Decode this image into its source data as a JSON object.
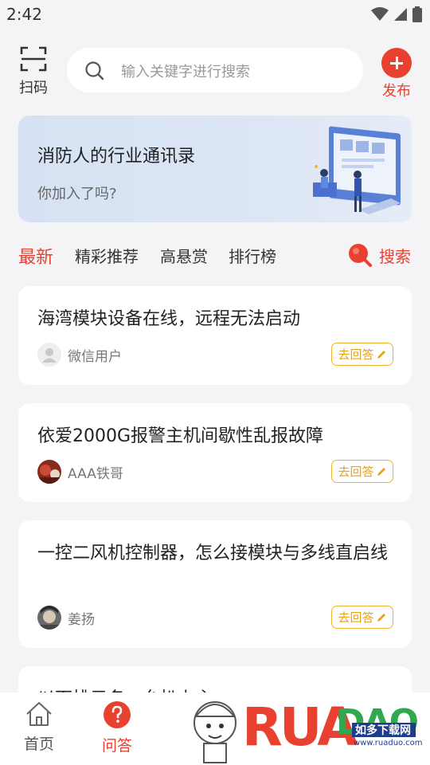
{
  "status": {
    "time": "2:42"
  },
  "header": {
    "scan_label": "扫码",
    "search_placeholder": "输入关键字进行搜索",
    "publish_label": "发布"
  },
  "banner": {
    "title": "消防人的行业通讯录",
    "subtitle": "你加入了吗?"
  },
  "tabs": [
    {
      "label": "最新",
      "active": true
    },
    {
      "label": "精彩推荐",
      "active": false
    },
    {
      "label": "高悬赏",
      "active": false
    },
    {
      "label": "排行榜",
      "active": false
    }
  ],
  "tabs_search_label": "搜索",
  "questions": [
    {
      "title": "海湾模块设备在线，远程无法启动",
      "user": "微信用户",
      "action": "去回答"
    },
    {
      "title": "依爱2000G报警主机间歇性乱报故障",
      "user": "AAA铁哥",
      "action": "去回答"
    },
    {
      "title": "一控二风机控制器，怎么接模块与多线直启线",
      "user": "姜扬",
      "action": "去回答"
    },
    {
      "title": "以下排示名一允扒上主"
    }
  ],
  "bottom_nav": [
    {
      "label": "首页",
      "icon": "home-icon",
      "active": false
    },
    {
      "label": "问答",
      "icon": "question-icon",
      "active": true
    }
  ],
  "watermark": {
    "brand": "RUANDAO",
    "tagline": "如多下载网",
    "url": "www.ruaduo.com"
  },
  "colors": {
    "accent": "#e8412f",
    "answer": "#e3a41c"
  }
}
